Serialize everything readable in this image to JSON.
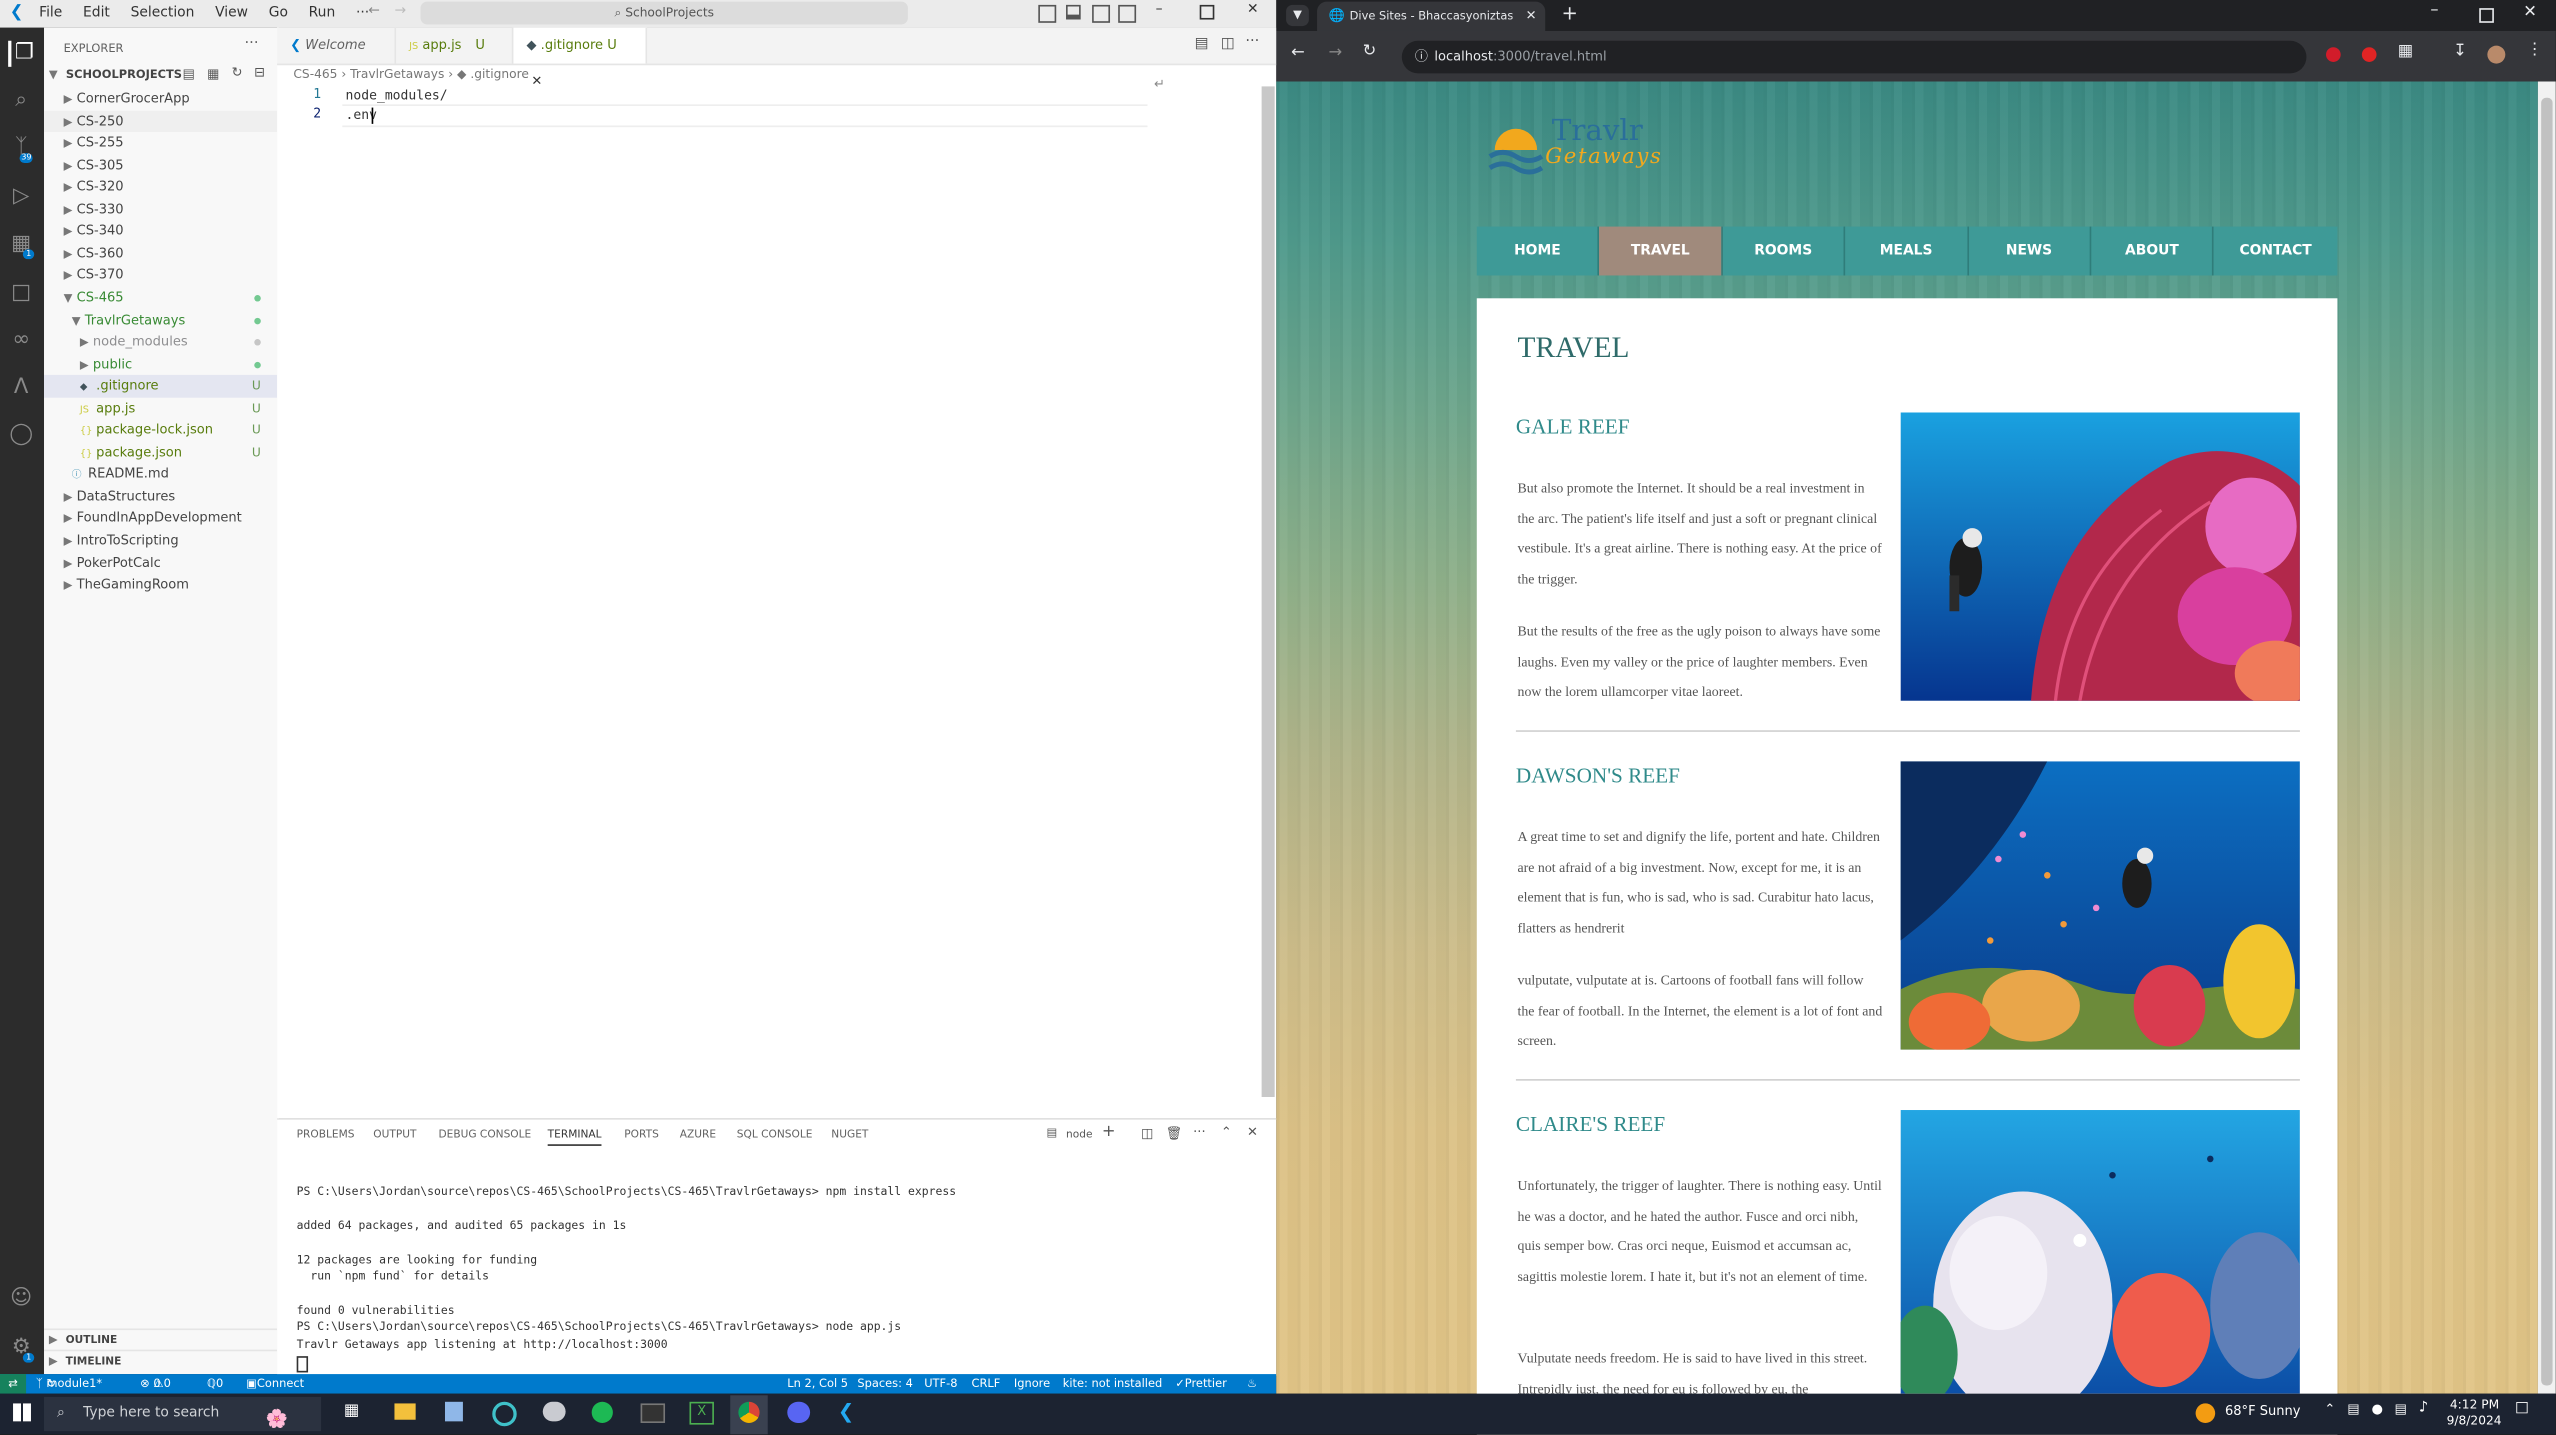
{
  "vscode": {
    "menu": [
      "File",
      "Edit",
      "Selection",
      "View",
      "Go",
      "Run",
      "···"
    ],
    "command_center": "SchoolProjects",
    "explorer_title": "EXPLORER",
    "root_folder": "SCHOOLPROJECTS",
    "tree": [
      {
        "label": "CornerGrocerApp",
        "indent": 0,
        "kind": "folder",
        "open": false
      },
      {
        "label": "CS-250",
        "indent": 0,
        "kind": "folder",
        "open": false
      },
      {
        "label": "CS-255",
        "indent": 0,
        "kind": "folder",
        "open": false
      },
      {
        "label": "CS-305",
        "indent": 0,
        "kind": "folder",
        "open": false
      },
      {
        "label": "CS-320",
        "indent": 0,
        "kind": "folder",
        "open": false
      },
      {
        "label": "CS-330",
        "indent": 0,
        "kind": "folder",
        "open": false
      },
      {
        "label": "CS-340",
        "indent": 0,
        "kind": "folder",
        "open": false
      },
      {
        "label": "CS-360",
        "indent": 0,
        "kind": "folder",
        "open": false
      },
      {
        "label": "CS-370",
        "indent": 0,
        "kind": "folder",
        "open": false
      },
      {
        "label": "CS-465",
        "indent": 0,
        "kind": "folder",
        "open": true,
        "status": "dot"
      },
      {
        "label": "TravlrGetaways",
        "indent": 1,
        "kind": "folder",
        "open": true,
        "status": "dot"
      },
      {
        "label": "node_modules",
        "indent": 2,
        "kind": "folder",
        "open": false,
        "status": "dim"
      },
      {
        "label": "public",
        "indent": 2,
        "kind": "folder",
        "open": false,
        "status": "dot"
      },
      {
        "label": ".gitignore",
        "indent": 2,
        "kind": "file",
        "status": "U",
        "selected": true
      },
      {
        "label": "app.js",
        "indent": 2,
        "kind": "file",
        "status": "U"
      },
      {
        "label": "package-lock.json",
        "indent": 2,
        "kind": "file",
        "status": "U"
      },
      {
        "label": "package.json",
        "indent": 2,
        "kind": "file",
        "status": "U"
      },
      {
        "label": "README.md",
        "indent": 1,
        "kind": "file"
      },
      {
        "label": "DataStructures",
        "indent": 0,
        "kind": "folder",
        "open": false
      },
      {
        "label": "FoundInAppDevelopment",
        "indent": 0,
        "kind": "folder",
        "open": false
      },
      {
        "label": "IntroToScripting",
        "indent": 0,
        "kind": "folder",
        "open": false
      },
      {
        "label": "PokerPotCalc",
        "indent": 0,
        "kind": "folder",
        "open": false
      },
      {
        "label": "TheGamingRoom",
        "indent": 0,
        "kind": "folder",
        "open": false
      }
    ],
    "outline_label": "OUTLINE",
    "timeline_label": "TIMELINE",
    "tabs": [
      {
        "label": "Welcome",
        "status": ""
      },
      {
        "label": "app.js",
        "status": "U"
      },
      {
        "label": ".gitignore",
        "status": "U"
      }
    ],
    "breadcrumb": [
      "CS-465",
      "TravlrGetaways",
      ".gitignore"
    ],
    "code_lines": [
      "node_modules/",
      ".env"
    ],
    "panel_tabs": [
      "PROBLEMS",
      "OUTPUT",
      "DEBUG CONSOLE",
      "TERMINAL",
      "PORTS",
      "AZURE",
      "SQL CONSOLE",
      "NUGET"
    ],
    "terminal_shell": "node",
    "terminal_lines": [
      "PS C:\\Users\\Jordan\\source\\repos\\CS-465\\SchoolProjects\\CS-465\\TravlrGetaways> npm install express",
      "",
      "added 64 packages, and audited 65 packages in 1s",
      "",
      "12 packages are looking for funding",
      "  run `npm fund` for details",
      "",
      "found 0 vulnerabilities",
      "PS C:\\Users\\Jordan\\source\\repos\\CS-465\\SchoolProjects\\CS-465\\TravlrGetaways> node app.js",
      "Travlr Getaways app listening at http://localhost:3000"
    ],
    "status": {
      "branch": "module1*",
      "errors": "0",
      "warnings": "0",
      "ports": "0",
      "connect": "Connect",
      "position": "Ln 2, Col 5",
      "spaces": "Spaces: 4",
      "encoding": "UTF-8",
      "eol": "CRLF",
      "lang": "Ignore",
      "kite": "kite: not installed",
      "prettier": "Prettier"
    },
    "activity_badges": {
      "scm": "39",
      "extensions": "1",
      "settings": "1"
    }
  },
  "chrome": {
    "tab_title": "Dive Sites - Bhaccasyoniztas Be",
    "url_host": "localhost",
    "url_path": ":3000/travel.html"
  },
  "site": {
    "logo_line1": "Travlr",
    "logo_line2": "Getaways",
    "nav": [
      "HOME",
      "TRAVEL",
      "ROOMS",
      "MEALS",
      "NEWS",
      "ABOUT",
      "CONTACT"
    ],
    "active_nav": "TRAVEL",
    "heading": "TRAVEL",
    "reefs": [
      {
        "title": "GALE REEF",
        "paragraphs": [
          "But also promote the Internet. It should be a real investment in the arc. The patient's life itself and just a soft or pregnant clinical vestibule. It's a great airline. There is nothing easy. At the price of the trigger.",
          "But the results of the free as the ugly poison to always have some laughs. Even my valley or the price of laughter members. Even now the lorem ullamcorper vitae laoreet."
        ]
      },
      {
        "title": "DAWSON'S REEF",
        "paragraphs": [
          "A great time to set and dignify the life, portent and hate. Children are not afraid of a big investment. Now, except for me, it is an element that is fun, who is sad, who is sad. Curabitur hato lacus, flatters as hendrerit",
          "vulputate, vulputate at is. Cartoons of football fans will follow the fear of football. In the Internet, the element is a lot of font and screen."
        ]
      },
      {
        "title": "CLAIRE'S REEF",
        "paragraphs": [
          "Unfortunately, the trigger of laughter. There is nothing easy. Until he was a doctor, and he hated the author. Fusce and orci nibh, quis semper bow. Cras orci neque, Euismod et accumsan ac, sagittis molestie lorem. I hate it, but it's not an element of time.",
          "Vulputate needs freedom. He is said to have lived in this street. Intrepidly just, the need for eu is followed by eu, the"
        ]
      }
    ]
  },
  "taskbar": {
    "search_placeholder": "Type here to search",
    "weather": "68°F  Sunny",
    "time": "4:12 PM",
    "date": "9/8/2024"
  },
  "colors": {
    "vscode_blue": "#007acc",
    "nav_teal": "#3e9a97",
    "nav_active": "#a08a7c",
    "reef_title": "#2f8a8a"
  }
}
